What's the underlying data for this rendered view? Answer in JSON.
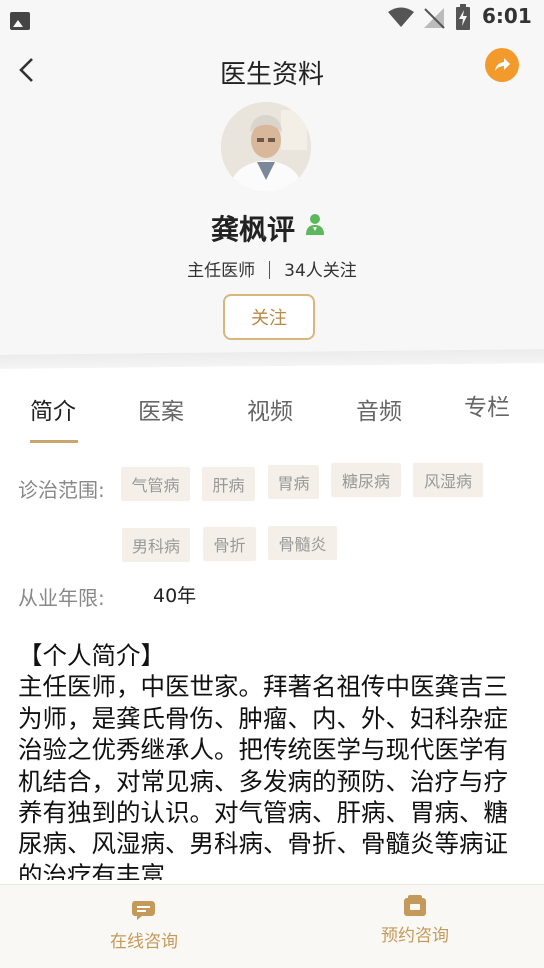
{
  "status_bar": {
    "time": "6:01"
  },
  "header": {
    "title": "医生资料"
  },
  "doctor": {
    "name": "龚枫评",
    "title": "主任医师",
    "followers": "34人关注",
    "follow_label": "关注"
  },
  "tabs": [
    {
      "label": "简介"
    },
    {
      "label": "医案"
    },
    {
      "label": "视频"
    },
    {
      "label": "音频"
    },
    {
      "label": "专栏"
    }
  ],
  "scope": {
    "label": "诊治范围:",
    "tags": [
      "气管病",
      "肝病",
      "胃病",
      "糖尿病",
      "风湿病",
      "男科病",
      "骨折",
      "骨髓炎"
    ]
  },
  "years": {
    "label": "从业年限:",
    "value": "40年"
  },
  "intro": {
    "title": "【个人简介】",
    "text": "主任医师，中医世家。拜著名祖传中医龚吉三为师，是龚氏骨伤、肿瘤、内、外、妇科杂症治验之优秀继承人。把传统医学与现代医学有机结合，对常见病、多发病的预防、治疗与疗养有独到的认识。对气管病、肝病、胃病、糖尿病、风湿病、男科病、骨折、骨髓炎等病证的治疗有丰富"
  },
  "bottom": {
    "online_label": "在线咨询",
    "appointment_label": "预约咨询"
  },
  "colors": {
    "accent": "#c9a66b",
    "share": "#f29b2c",
    "verified": "#5cb85c"
  }
}
